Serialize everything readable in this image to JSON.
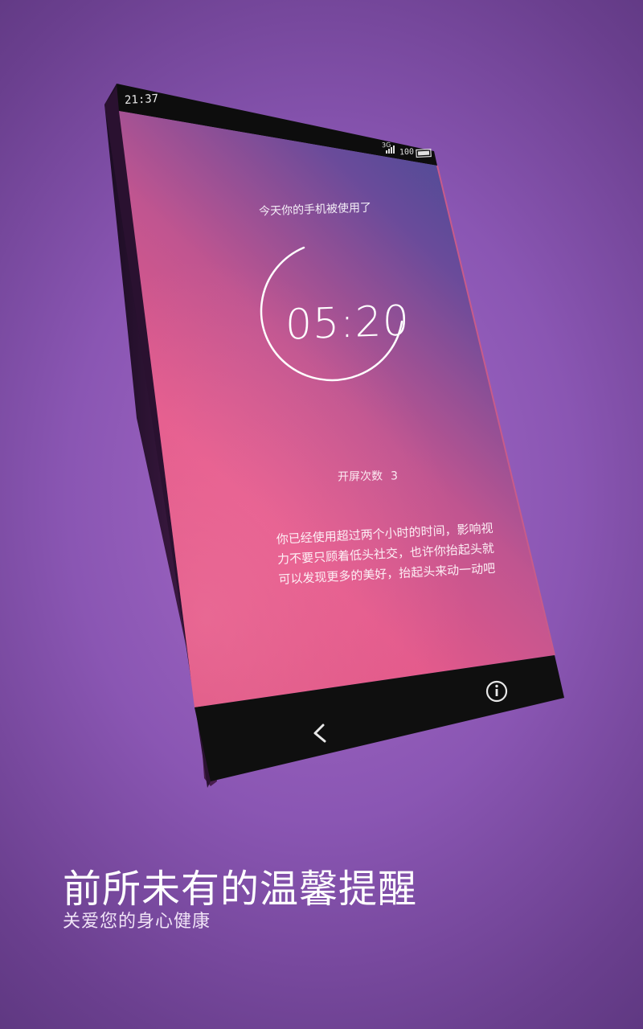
{
  "status_bar": {
    "time": "21:37",
    "network": "3G",
    "battery": "100"
  },
  "screen": {
    "title": "今天你的手机被使用了",
    "timer": "05:20",
    "unlock_label": "开屏次数",
    "unlock_count": "3",
    "message": "你已经使用超过两个小时的时间，影响视力不要只顾着低头社交，也许你抬起头就可以发现更多的美好，抬起头来动一动吧"
  },
  "nav": {
    "back_icon": "chevron-left-icon",
    "info_icon": "info-circle-icon"
  },
  "promo": {
    "headline": "前所未有的温馨提醒",
    "subline": "关爱您的身心健康"
  },
  "colors": {
    "background": "#8a56b3",
    "screen_top": "#3f4d96",
    "screen_bottom": "#e0567f",
    "bezel": "#111111"
  }
}
